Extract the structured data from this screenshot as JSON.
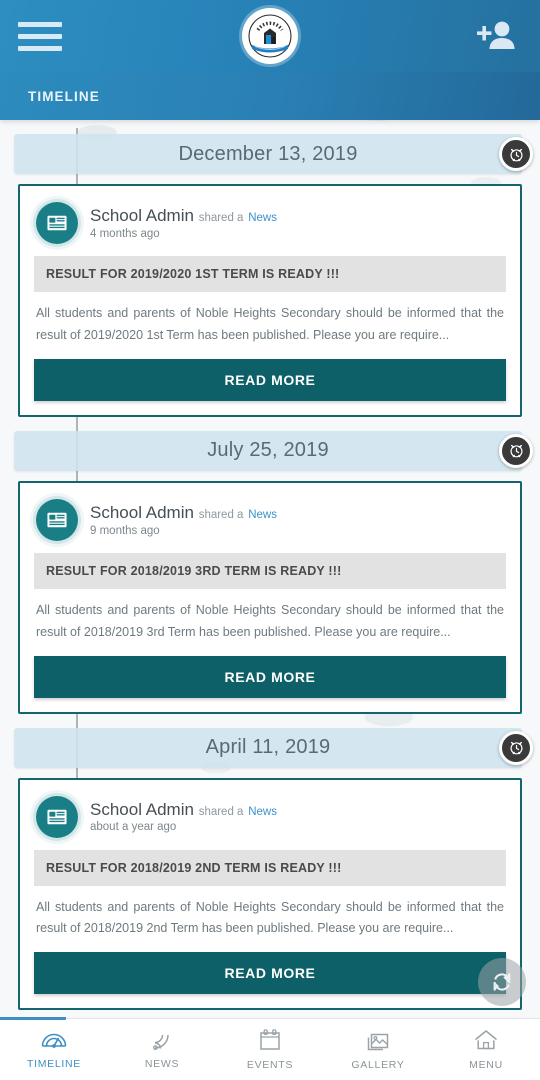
{
  "header": {
    "menu_icon": "hamburger-menu-icon",
    "logo_alt": "school-crest-logo",
    "add_user_icon": "person-add-icon",
    "tab_label": "TIMELINE"
  },
  "colors": {
    "header_blue": "#2782b8",
    "accent_teal": "#0d6068",
    "card_border": "#14666e",
    "date_banner_bg": "#cfe2ee",
    "link_blue": "#3b93cc",
    "active_nav": "#3f8fc4"
  },
  "timeline": {
    "groups": [
      {
        "date": "December 13, 2019",
        "alarm_icon": "alarm-clock-icon",
        "post": {
          "avatar_icon": "news-icon",
          "author": "School Admin",
          "shared_text": "shared a",
          "post_type": "News",
          "time_ago": "4 months ago",
          "title": "RESULT FOR 2019/2020 1ST TERM IS READY !!!",
          "body": "All students and parents of Noble Heights Secondary should be informed that the result of 2019/2020 1st Term has been published. Please you are require...",
          "read_more_label": "READ MORE"
        }
      },
      {
        "date": "July 25, 2019",
        "alarm_icon": "alarm-clock-icon",
        "post": {
          "avatar_icon": "news-icon",
          "author": "School Admin",
          "shared_text": "shared a",
          "post_type": "News",
          "time_ago": "9 months ago",
          "title": "RESULT FOR 2018/2019 3RD TERM IS READY !!!",
          "body": "All students and parents of Noble Heights Secondary should be informed that the result of 2018/2019 3rd Term has been published. Please you are require...",
          "read_more_label": "READ MORE"
        }
      },
      {
        "date": "April 11, 2019",
        "alarm_icon": "alarm-clock-icon",
        "post": {
          "avatar_icon": "news-icon",
          "author": "School Admin",
          "shared_text": "shared a",
          "post_type": "News",
          "time_ago": "about a year ago",
          "title": "RESULT FOR 2018/2019 2ND TERM IS READY !!!",
          "body": "All students and parents of Noble Heights Secondary should be informed that the result of 2018/2019 2nd Term has been published. Please you are require...",
          "read_more_label": "READ MORE"
        }
      }
    ]
  },
  "refresh": {
    "icon": "refresh-icon"
  },
  "bottom_nav": {
    "items": [
      {
        "label": "TIMELINE",
        "icon": "speedometer-icon",
        "active": true
      },
      {
        "label": "NEWS",
        "icon": "rss-feed-icon",
        "active": false
      },
      {
        "label": "EVENTS",
        "icon": "calendar-icon",
        "active": false
      },
      {
        "label": "GALLERY",
        "icon": "photo-stack-icon",
        "active": false
      },
      {
        "label": "MENU",
        "icon": "home-icon",
        "active": false
      }
    ]
  }
}
